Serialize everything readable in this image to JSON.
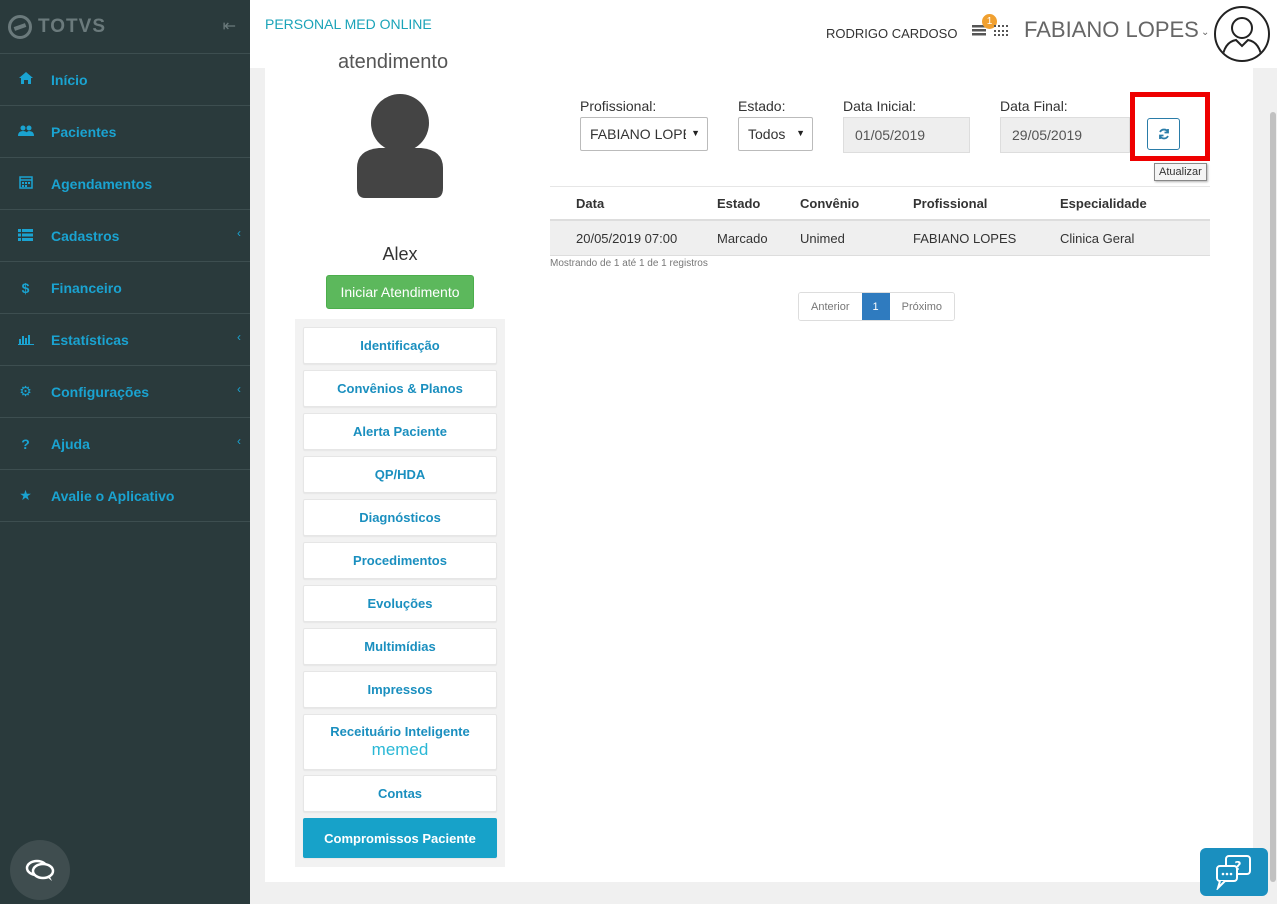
{
  "brand": {
    "name": "TOTVS"
  },
  "sidebar": {
    "items": [
      {
        "label": "Início",
        "icon": "home-icon"
      },
      {
        "label": "Pacientes",
        "icon": "users-icon"
      },
      {
        "label": "Agendamentos",
        "icon": "calendar-icon"
      },
      {
        "label": "Cadastros",
        "icon": "list-icon"
      },
      {
        "label": "Financeiro",
        "icon": "dollar-icon"
      },
      {
        "label": "Estatísticas",
        "icon": "bar-chart-icon"
      },
      {
        "label": "Configurações",
        "icon": "gear-icon"
      },
      {
        "label": "Ajuda",
        "icon": "question-icon"
      },
      {
        "label": "Avalie o Aplicativo",
        "icon": "star-icon"
      }
    ]
  },
  "header": {
    "app_title": "PERSONAL MED ONLINE",
    "secondary_user": "RODRIGO CARDOSO",
    "notification_count": "1",
    "main_user": "FABIANO LOPES"
  },
  "patient": {
    "header_text": "atendimento",
    "name": "Alex",
    "start_button": "Iniciar Atendimento",
    "menu": [
      "Identificação",
      "Convênios & Planos",
      "Alerta Paciente",
      "QP/HDA",
      "Diagnósticos",
      "Procedimentos",
      "Evoluções",
      "Multimídias",
      "Impressos",
      "Receituário Inteligente",
      "Contas",
      "Compromissos Paciente"
    ],
    "memed_label": "memed"
  },
  "filters": {
    "profissional_label": "Profissional:",
    "profissional_value": "FABIANO LOPES",
    "estado_label": "Estado:",
    "estado_value": "Todos",
    "data_inicial_label": "Data Inicial:",
    "data_inicial_value": "01/05/2019",
    "data_final_label": "Data Final:",
    "data_final_value": "29/05/2019",
    "refresh_tooltip": "Atualizar"
  },
  "table": {
    "headers": [
      "Data",
      "Estado",
      "Convênio",
      "Profissional",
      "Especialidade"
    ],
    "rows": [
      [
        "20/05/2019 07:00",
        "Marcado",
        "Unimed",
        "FABIANO LOPES",
        "Clinica Geral"
      ]
    ],
    "info": "Mostrando de 1 até 1 de 1 registros"
  },
  "pagination": {
    "prev": "Anterior",
    "current": "1",
    "next": "Próximo"
  },
  "colors": {
    "sidebar_bg": "#2a3a3c",
    "accent": "#1aa3d1",
    "success": "#5cb85c",
    "active_menu": "#17a2c9",
    "highlight": "#ee0000"
  }
}
